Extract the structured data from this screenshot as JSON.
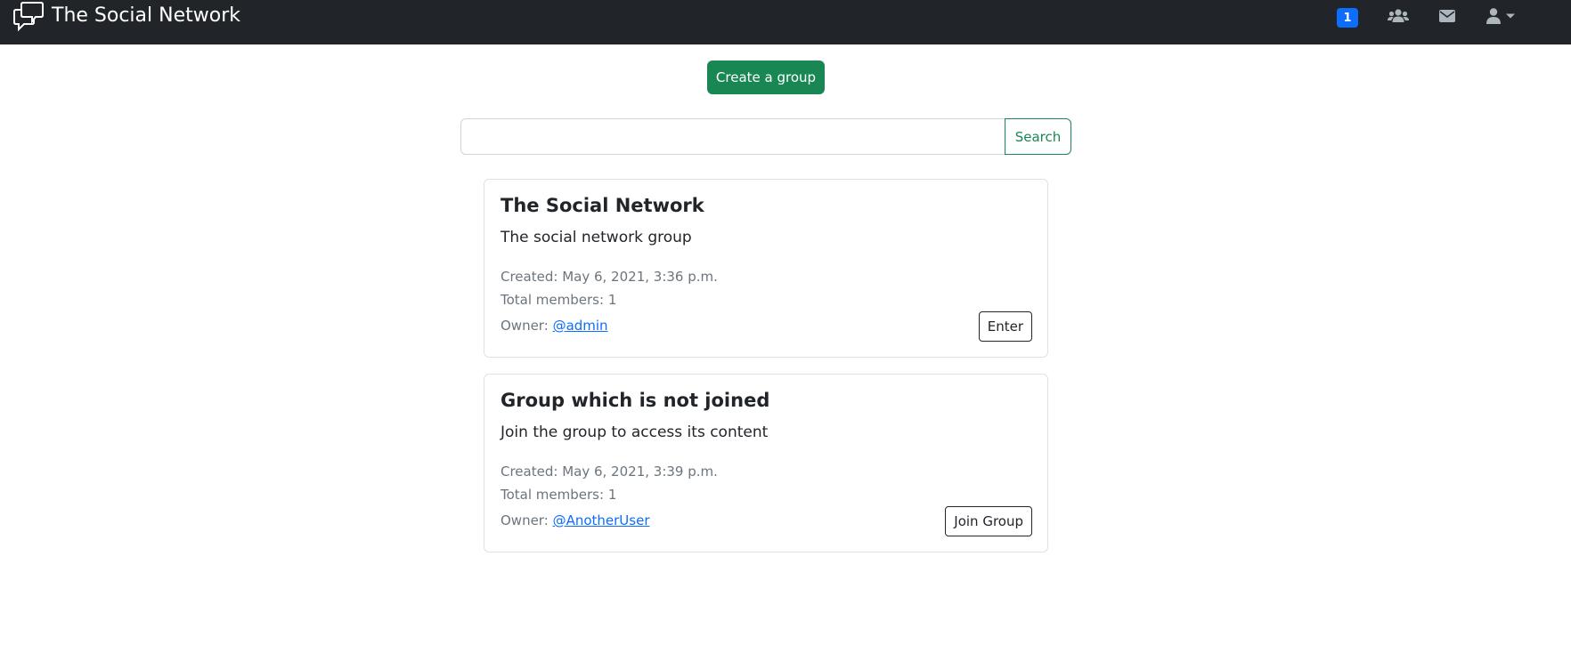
{
  "navbar": {
    "brand_title": "The Social Network",
    "brand_icon": "chat-bubbles-icon",
    "notification_count": "1",
    "icons": [
      "users-icon",
      "envelope-icon",
      "user-icon",
      "caret-down-icon"
    ],
    "background_color": "#212529"
  },
  "actions": {
    "create_group_label": "Create a group",
    "create_group_color": "#198754"
  },
  "search": {
    "value": "",
    "placeholder": "",
    "button_label": "Search"
  },
  "groups": [
    {
      "name": "The Social Network",
      "description": "The social network group",
      "created_label": "Created:",
      "created": "May 6, 2021, 3:36 p.m.",
      "members_label": "Total members:",
      "members": "1",
      "owner_label": "Owner:",
      "owner": "@admin",
      "action_label": "Enter"
    },
    {
      "name": "Group which is not joined",
      "description": "Join the group to access its content",
      "created_label": "Created:",
      "created": "May 6, 2021, 3:39 p.m.",
      "members_label": "Total members:",
      "members": "1",
      "owner_label": "Owner:",
      "owner": "@AnotherUser",
      "action_label": "Join Group"
    }
  ]
}
